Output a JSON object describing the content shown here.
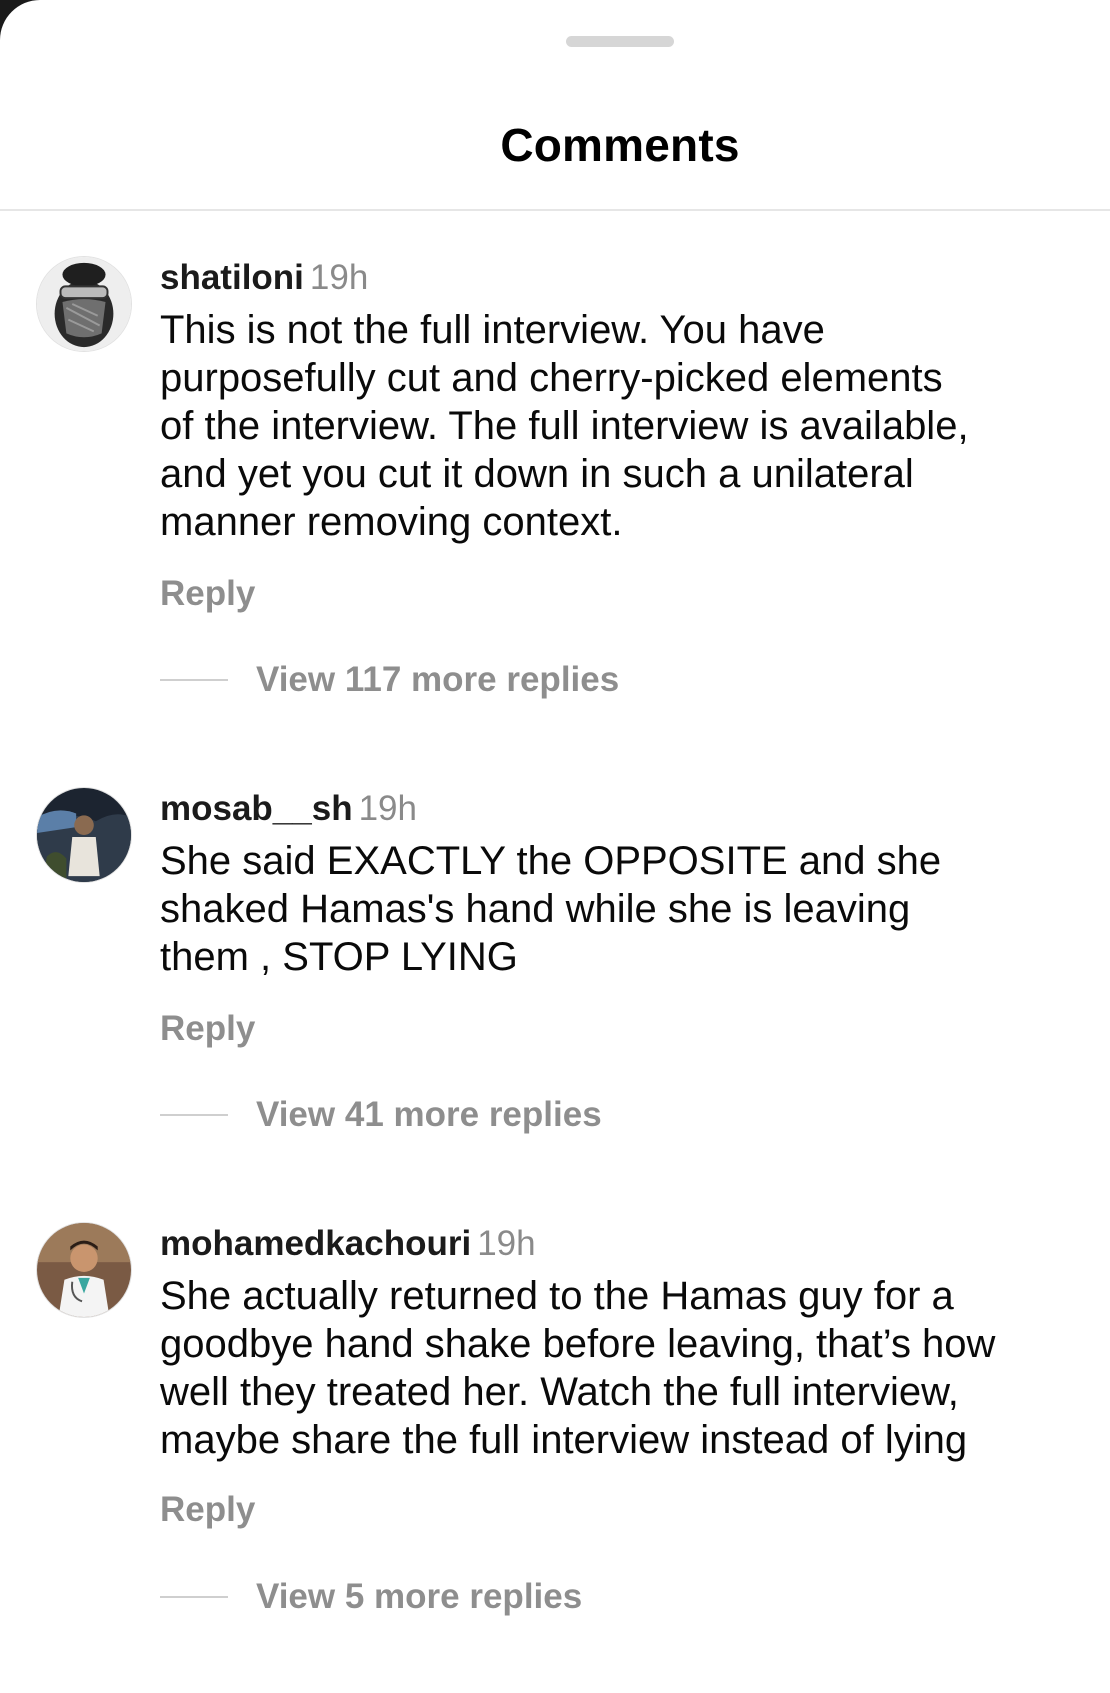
{
  "header": {
    "title": "Comments"
  },
  "comments": [
    {
      "username": "shatiloni",
      "time": "19h",
      "avatar": "masked-face-avatar",
      "lines": [
        "This is not the full interview. You have",
        "purposefully cut and cherry-picked elements",
        "of the interview. The full interview is available,",
        "and yet you cut it down in such a unilateral",
        "manner removing context."
      ],
      "reply_label": "Reply",
      "view_replies_label": "View 117 more replies"
    },
    {
      "username": "mosab__sh",
      "time": "19h",
      "avatar": "person-outdoors-avatar",
      "lines": [
        "She said EXACTLY the OPPOSITE and she",
        "shaked Hamas's hand while she is leaving",
        "them , STOP LYING"
      ],
      "reply_label": "Reply",
      "view_replies_label": "View 41 more replies"
    },
    {
      "username": "mohamedkachouri",
      "time": "19h",
      "avatar": "doctor-avatar",
      "lines": [
        "She actually returned to the Hamas guy for a",
        "goodbye hand shake before leaving, that’s how",
        "well they treated her. Watch the full interview,",
        "maybe share the full interview instead of lying"
      ],
      "reply_label": "Reply",
      "view_replies_label": "View 5 more replies"
    }
  ]
}
